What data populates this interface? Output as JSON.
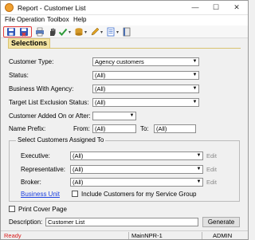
{
  "window": {
    "title": "Report - Customer List",
    "controls": {
      "minimize": "—",
      "maximize": "☐",
      "close": "✕"
    }
  },
  "menu": [
    "File",
    "Operation",
    "Toolbox",
    "Help"
  ],
  "toolbar": {
    "icons": [
      "save-icon",
      "save-close-icon",
      "print-icon",
      "hand-icon",
      "checkmark-icon",
      "database-icon",
      "pen-icon",
      "document-icon",
      "book-icon"
    ]
  },
  "section": {
    "title": "Selections"
  },
  "fields": {
    "customer_type": {
      "label": "Customer Type:",
      "value": "Agency customers"
    },
    "status": {
      "label": "Status:",
      "value": "(All)"
    },
    "business_with_agency": {
      "label": "Business With Agency:",
      "value": "(All)"
    },
    "target_list_exclusion_status": {
      "label": "Target List Exclusion Status:",
      "value": "(All)"
    },
    "customer_added": {
      "label": "Customer Added On or After:",
      "value": ""
    },
    "name_prefix": {
      "label": "Name Prefix:",
      "from_label": "From:",
      "from_value": "(All)",
      "to_label": "To:",
      "to_value": "(All)"
    }
  },
  "assigned": {
    "title": "Select Customers Assigned To",
    "rows": [
      {
        "label": "Executive:",
        "value": "(All)",
        "edit": "Edit"
      },
      {
        "label": "Representative:",
        "value": "(All)",
        "edit": "Edit"
      },
      {
        "label": "Broker:",
        "value": "(All)",
        "edit": "Edit"
      }
    ],
    "business_unit_link": "Business Unit",
    "include_service_group_label": "Include Customers for my Service Group"
  },
  "print_cover_page": {
    "label": "Print Cover Page",
    "checked": false
  },
  "description": {
    "label": "Description:",
    "value": "Customer List"
  },
  "generate_label": "Generate",
  "statusbar": {
    "status": "Ready",
    "server": "MainNPR-1",
    "user": "ADMIN"
  },
  "colors": {
    "ready": "#d81b1b",
    "link": "#1a3fe0",
    "section_bg": "#f3e4a3",
    "highlight": "#e23b3b"
  }
}
